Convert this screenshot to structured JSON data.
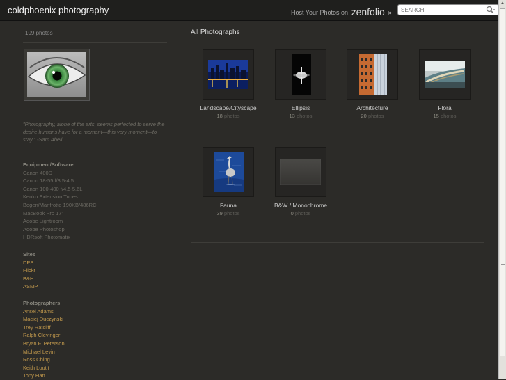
{
  "header": {
    "site_title": "coldphoenix photography",
    "host_prefix": "Host Your Photos on",
    "host_brand": "zenfolio",
    "host_arrow": "»",
    "search_placeholder": "SEARCH"
  },
  "sidebar": {
    "photo_count": "109 photos",
    "quote": "\"Photography, alone of the arts, seems perfected to serve the desire humans have for a moment—this very moment—to stay.\" -Sam Abell",
    "equipment_heading": "Equipment/Software",
    "equipment": [
      "Canon 400D",
      "Canon 18-55 f/3.5-4.5",
      "Canon 100-400 f/4.5-5.6L",
      "Kenko Extension Tubes",
      "Bogen/Manfrotto 190XB/486RC",
      "MacBook Pro 17\"",
      "Adobe Lightroom",
      "Adobe Photoshop",
      "HDRsoft Photomatix"
    ],
    "sites_heading": "Sites",
    "sites": [
      "DPS",
      "Flickr",
      "B&H",
      "ASMP"
    ],
    "photographers_heading": "Photographers",
    "photographers": [
      "Ansel Adams",
      "Maciej Duczynski",
      "Trey Ratcliff",
      "Ralph Clevinger",
      "Bryan F. Peterson",
      "Michael Levin",
      "Ross Ching",
      "Keith Loutit",
      "Tony Han"
    ]
  },
  "main": {
    "title": "All Photographs",
    "count_suffix": "photos",
    "galleries": [
      {
        "title": "Landscape/Cityscape",
        "count": "18"
      },
      {
        "title": "Ellipsis",
        "count": "13"
      },
      {
        "title": "Architecture",
        "count": "20"
      },
      {
        "title": "Flora",
        "count": "15"
      },
      {
        "title": "Fauna",
        "count": "39"
      },
      {
        "title": "B&W / Monochrome",
        "count": "0"
      }
    ]
  },
  "colors": {
    "background": "#2c2b28",
    "topbar": "#1f1f1d",
    "link": "#c39a4d",
    "muted_text": "#6c6a63"
  }
}
